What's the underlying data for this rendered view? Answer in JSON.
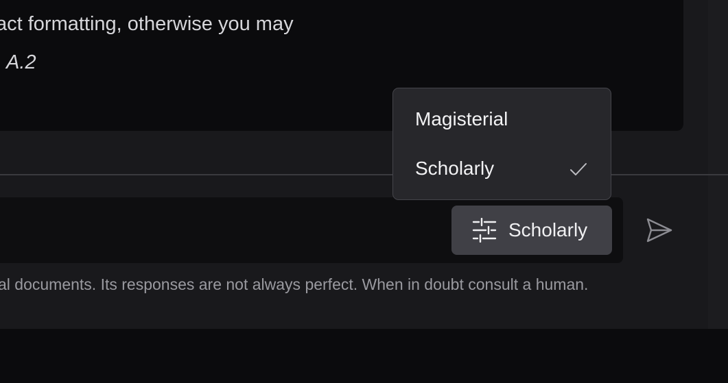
{
  "message": {
    "line1": "act formatting, otherwise you may",
    "line2": ". A.2"
  },
  "composer": {
    "style_button_label": "Scholarly",
    "style_icon": "sliders-icon",
    "send_icon": "send-icon"
  },
  "style_menu": {
    "options": [
      {
        "label": "Magisterial",
        "selected": false
      },
      {
        "label": "Scholarly",
        "selected": true
      }
    ],
    "selected_icon": "check-icon"
  },
  "disclaimer": "al documents. Its responses are not always perfect. When in doubt consult a human.",
  "colors": {
    "background": "#0b0b0d",
    "panel": "#19191c",
    "button": "#404046",
    "menu": "#27272b",
    "text": "#f2f2f4",
    "muted_text": "#9a9aa0"
  }
}
